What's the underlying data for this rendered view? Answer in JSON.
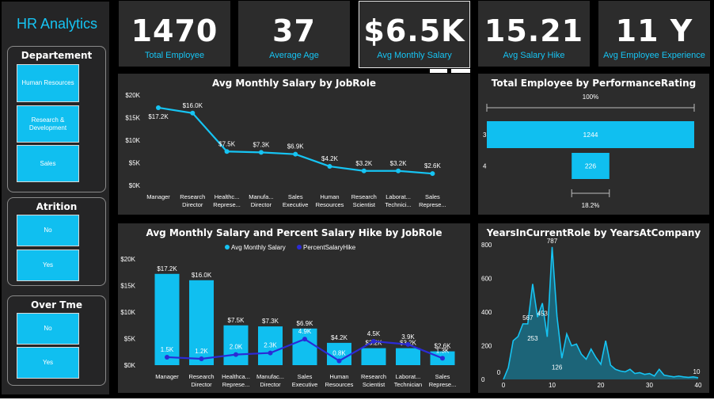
{
  "app": {
    "title": "HR Analytics"
  },
  "slicers": {
    "department": {
      "title": "Departement",
      "items": [
        "Human Resources",
        "Research & Development",
        "Sales"
      ]
    },
    "attrition": {
      "title": "Atrition",
      "items": [
        "No",
        "Yes"
      ]
    },
    "overtime": {
      "title": "Over Tme",
      "items": [
        "No",
        "Yes"
      ]
    }
  },
  "kpis": [
    {
      "value": "1470",
      "label": "Total Employee"
    },
    {
      "value": "37",
      "label": "Average Age"
    },
    {
      "value": "$6.5K",
      "label": "Avg Monthly Salary"
    },
    {
      "value": "15.21",
      "label": "Avg Salary Hike"
    },
    {
      "value": "11 Y",
      "label": "Avg Employee Experience"
    }
  ],
  "colors": {
    "accent": "#16c4f3",
    "bar": "#10bff0",
    "line2": "#2b2bd6",
    "panel": "#2c2c2c",
    "sidebar": "#252526"
  },
  "chart_data": [
    {
      "id": "salary_line",
      "type": "line",
      "title": "Avg Monthly Salary by JobRole",
      "categories": [
        "Manager",
        "Research Director",
        "Healthcare Representative",
        "Manufacturing Director",
        "Sales Executive",
        "Human Resources",
        "Research Scientist",
        "Laboratory Technician",
        "Sales Representative"
      ],
      "tick_labels": [
        [
          "Manager"
        ],
        [
          "Research",
          "Director"
        ],
        [
          "Healthc...",
          "Represe..."
        ],
        [
          "Manufa...",
          "Director"
        ],
        [
          "Sales",
          "Executive"
        ],
        [
          "Human",
          "Resources"
        ],
        [
          "Research",
          "Scientist"
        ],
        [
          "Laborat...",
          "Technici..."
        ],
        [
          "Sales",
          "Represe..."
        ]
      ],
      "values": [
        17200,
        16000,
        7500,
        7300,
        6900,
        4200,
        3200,
        3200,
        2600
      ],
      "data_labels": [
        "$17.2K",
        "$16.0K",
        "$7.5K",
        "$7.3K",
        "$6.9K",
        "$4.2K",
        "$3.2K",
        "$3.2K",
        "$2.6K"
      ],
      "y_ticks": [
        "$0K",
        "$5K",
        "$10K",
        "$15K",
        "$20K"
      ],
      "ylim": [
        0,
        20000
      ]
    },
    {
      "id": "performance_bar",
      "type": "bar",
      "title": "Total Employee by PerformanceRating",
      "categories": [
        "3",
        "4"
      ],
      "values": [
        1244,
        226
      ],
      "data_labels": [
        "1244",
        "226"
      ],
      "annotations": [
        "100%",
        "18.2%"
      ]
    },
    {
      "id": "salary_combo",
      "type": "bar",
      "title": "Avg Monthly Salary and Percent Salary Hike by JobRole",
      "legend": [
        "Avg Monthly Salary",
        "PercentSalaryHike"
      ],
      "categories": [
        "Manager",
        "Research Director",
        "Healthcare Representative",
        "Manufacturing Director",
        "Sales Executive",
        "Human Resources",
        "Research Scientist",
        "Laboratory Technician",
        "Sales Representative"
      ],
      "tick_labels": [
        [
          "Manager"
        ],
        [
          "Research",
          "Director"
        ],
        [
          "Healthca...",
          "Represe..."
        ],
        [
          "Manufac...",
          "Director"
        ],
        [
          "Sales",
          "Executive"
        ],
        [
          "Human",
          "Resources"
        ],
        [
          "Research",
          "Scientist"
        ],
        [
          "Laborat...",
          "Technician"
        ],
        [
          "Sales",
          "Represe..."
        ]
      ],
      "series": [
        {
          "name": "Avg Monthly Salary",
          "values": [
            17200,
            16000,
            7500,
            7300,
            6900,
            4200,
            3200,
            3200,
            2600
          ],
          "labels": [
            "$17.2K",
            "$16.0K",
            "$7.5K",
            "$7.3K",
            "$6.9K",
            "$4.2K",
            "$3.2K",
            "$3.2K",
            "$2.6K"
          ]
        },
        {
          "name": "PercentSalaryHike",
          "values": [
            1500,
            1200,
            2000,
            2300,
            4900,
            800,
            4500,
            3900,
            1300
          ],
          "labels": [
            "1.5K",
            "1.2K",
            "2.0K",
            "2.3K",
            "4.9K",
            "0.8K",
            "4.5K",
            "3.9K",
            "1.3K"
          ]
        }
      ],
      "y_ticks": [
        "$0K",
        "$5K",
        "$10K",
        "$15K",
        "$20K"
      ],
      "ylim": [
        0,
        20000
      ]
    },
    {
      "id": "years_area",
      "type": "area",
      "title": "YearsInCurrentRole by YearsAtCompany",
      "x": [
        0,
        1,
        2,
        3,
        4,
        5,
        6,
        7,
        8,
        9,
        10,
        11,
        12,
        13,
        14,
        15,
        16,
        17,
        18,
        19,
        20,
        21,
        22,
        23,
        24,
        25,
        26,
        27,
        28,
        29,
        30,
        31,
        32,
        33,
        34,
        35,
        36,
        37,
        38,
        39,
        40
      ],
      "values": [
        0,
        70,
        230,
        255,
        330,
        330,
        567,
        370,
        453,
        253,
        787,
        375,
        126,
        270,
        200,
        210,
        150,
        120,
        180,
        130,
        90,
        230,
        85,
        60,
        50,
        45,
        60,
        35,
        40,
        30,
        35,
        20,
        60,
        25,
        20,
        15,
        20,
        15,
        12,
        15,
        10
      ],
      "data_labels": [
        {
          "x": 0,
          "text": "0"
        },
        {
          "x": 5,
          "text": "567"
        },
        {
          "x": 8,
          "text": "453"
        },
        {
          "x": 6,
          "text": "253"
        },
        {
          "x": 10,
          "text": "787"
        },
        {
          "x": 11,
          "text": "126"
        },
        {
          "x": 40,
          "text": "10"
        }
      ],
      "x_ticks": [
        "0",
        "10",
        "20",
        "30",
        "40"
      ],
      "y_ticks": [
        "0",
        "200",
        "400",
        "600",
        "800"
      ],
      "xlim": [
        0,
        40
      ],
      "ylim": [
        0,
        800
      ]
    }
  ]
}
